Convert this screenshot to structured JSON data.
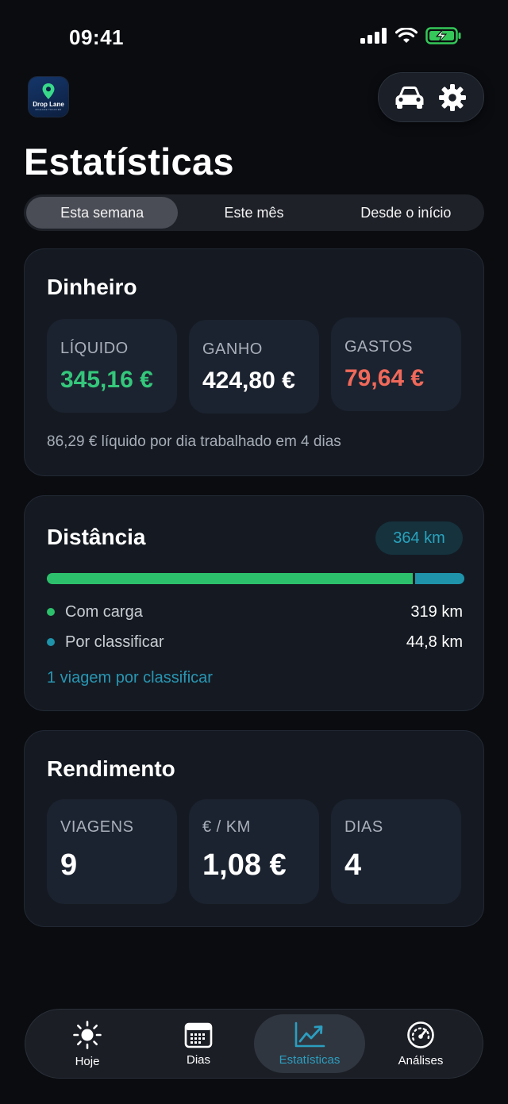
{
  "status": {
    "time": "09:41"
  },
  "app": {
    "logo_text": "Drop Lane",
    "logo_sub": "MILEAGE TRACKER"
  },
  "page": {
    "title": "Estatísticas"
  },
  "periods": [
    {
      "label": "Esta semana",
      "active": true
    },
    {
      "label": "Este mês",
      "active": false
    },
    {
      "label": "Desde o início",
      "active": false
    }
  ],
  "money": {
    "title": "Dinheiro",
    "tiles": [
      {
        "label": "LÍQUIDO",
        "value": "345,16 €",
        "color": "#34c77b"
      },
      {
        "label": "GANHO",
        "value": "424,80 €",
        "color": "#ffffff"
      },
      {
        "label": "GASTOS",
        "value": "79,64 €",
        "color": "#f0695a"
      }
    ],
    "note": "86,29 € líquido por dia trabalhado em 4 dias"
  },
  "distance": {
    "title": "Distância",
    "total": "364 km",
    "loaded_fraction": 0.877,
    "legend": [
      {
        "label": "Com carga",
        "value": "319 km",
        "color": "#2dc06c"
      },
      {
        "label": "Por classificar",
        "value": "44,8 km",
        "color": "#1e93aa"
      }
    ],
    "link": "1 viagem por classificar"
  },
  "performance": {
    "title": "Rendimento",
    "tiles": [
      {
        "label": "VIAGENS",
        "value": "9"
      },
      {
        "label": "€ / KM",
        "value": "1,08 €"
      },
      {
        "label": "DIAS",
        "value": "4"
      }
    ]
  },
  "tabs": [
    {
      "label": "Hoje",
      "icon": "sun-icon",
      "active": false
    },
    {
      "label": "Dias",
      "icon": "calendar-icon",
      "active": false
    },
    {
      "label": "Estatísticas",
      "icon": "chart-line-icon",
      "active": true
    },
    {
      "label": "Análises",
      "icon": "speedometer-icon",
      "active": false
    }
  ]
}
